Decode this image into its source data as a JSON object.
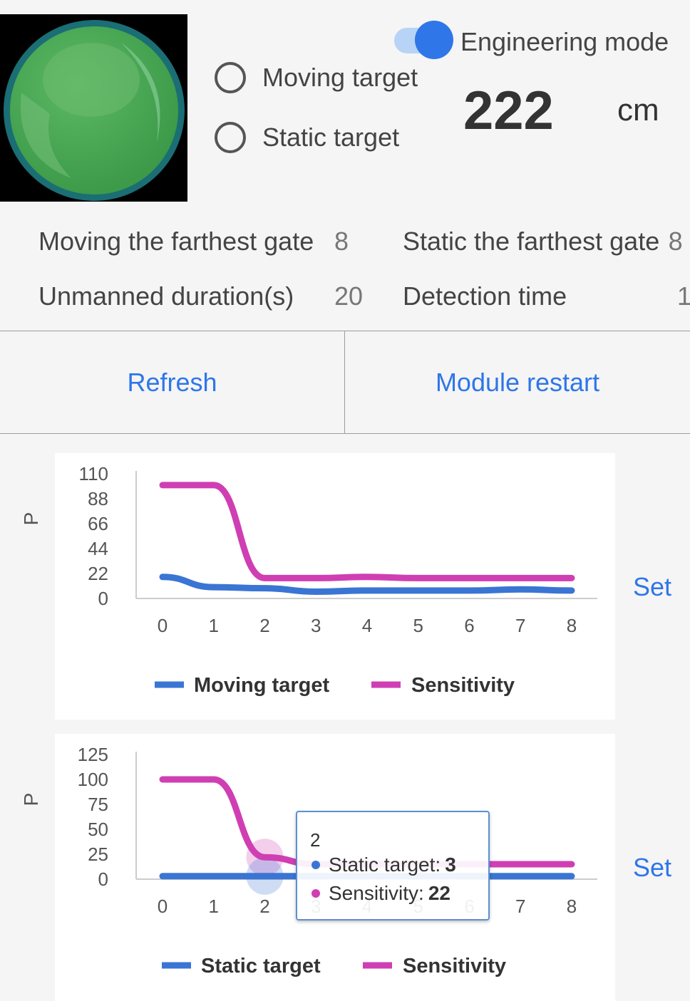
{
  "header": {
    "radios": [
      {
        "label": "Moving target"
      },
      {
        "label": "Static target"
      }
    ],
    "engineering_mode_label": "Engineering mode",
    "distance_value": "222",
    "distance_unit": "cm"
  },
  "params": {
    "moving_gate_label": "Moving the farthest gate",
    "moving_gate_value": "8",
    "static_gate_label": "Static the farthest gate",
    "static_gate_value": "8",
    "unmanned_label": "Unmanned duration(s)",
    "unmanned_value": "20",
    "detection_label": "Detection time",
    "detection_value": "1"
  },
  "buttons": {
    "refresh": "Refresh",
    "restart": "Module restart",
    "set": "Set"
  },
  "colors": {
    "accent": "#2f76e8",
    "series_blue": "#3a75d4",
    "series_magenta": "#cf3fb3"
  },
  "chart_data": [
    {
      "type": "line",
      "ylabel": "P",
      "yticks": [
        0,
        22,
        44,
        66,
        88,
        110
      ],
      "ylim": [
        0,
        110
      ],
      "x": [
        0,
        1,
        2,
        3,
        4,
        5,
        6,
        7,
        8
      ],
      "series": [
        {
          "name": "Moving target",
          "values": [
            19,
            10,
            9,
            6,
            7,
            7,
            7,
            8,
            7
          ]
        },
        {
          "name": "Sensitivity",
          "values": [
            100,
            100,
            18,
            18,
            19,
            18,
            18,
            18,
            18
          ]
        }
      ]
    },
    {
      "type": "line",
      "ylabel": "P",
      "yticks": [
        0,
        25,
        50,
        75,
        100,
        125
      ],
      "ylim": [
        0,
        125
      ],
      "x": [
        0,
        1,
        2,
        3,
        4,
        5,
        6,
        7,
        8
      ],
      "series": [
        {
          "name": "Static target",
          "values": [
            3,
            3,
            3,
            3,
            3,
            3,
            3,
            3,
            3
          ]
        },
        {
          "name": "Sensitivity",
          "values": [
            100,
            100,
            22,
            15,
            15,
            15,
            15,
            15,
            15
          ]
        }
      ],
      "tooltip": {
        "x": "2",
        "rows": [
          {
            "name": "Static target",
            "sep": ": ",
            "value": "3"
          },
          {
            "name": "Sensitivity",
            "sep": ": ",
            "value": "22"
          }
        ]
      }
    }
  ]
}
